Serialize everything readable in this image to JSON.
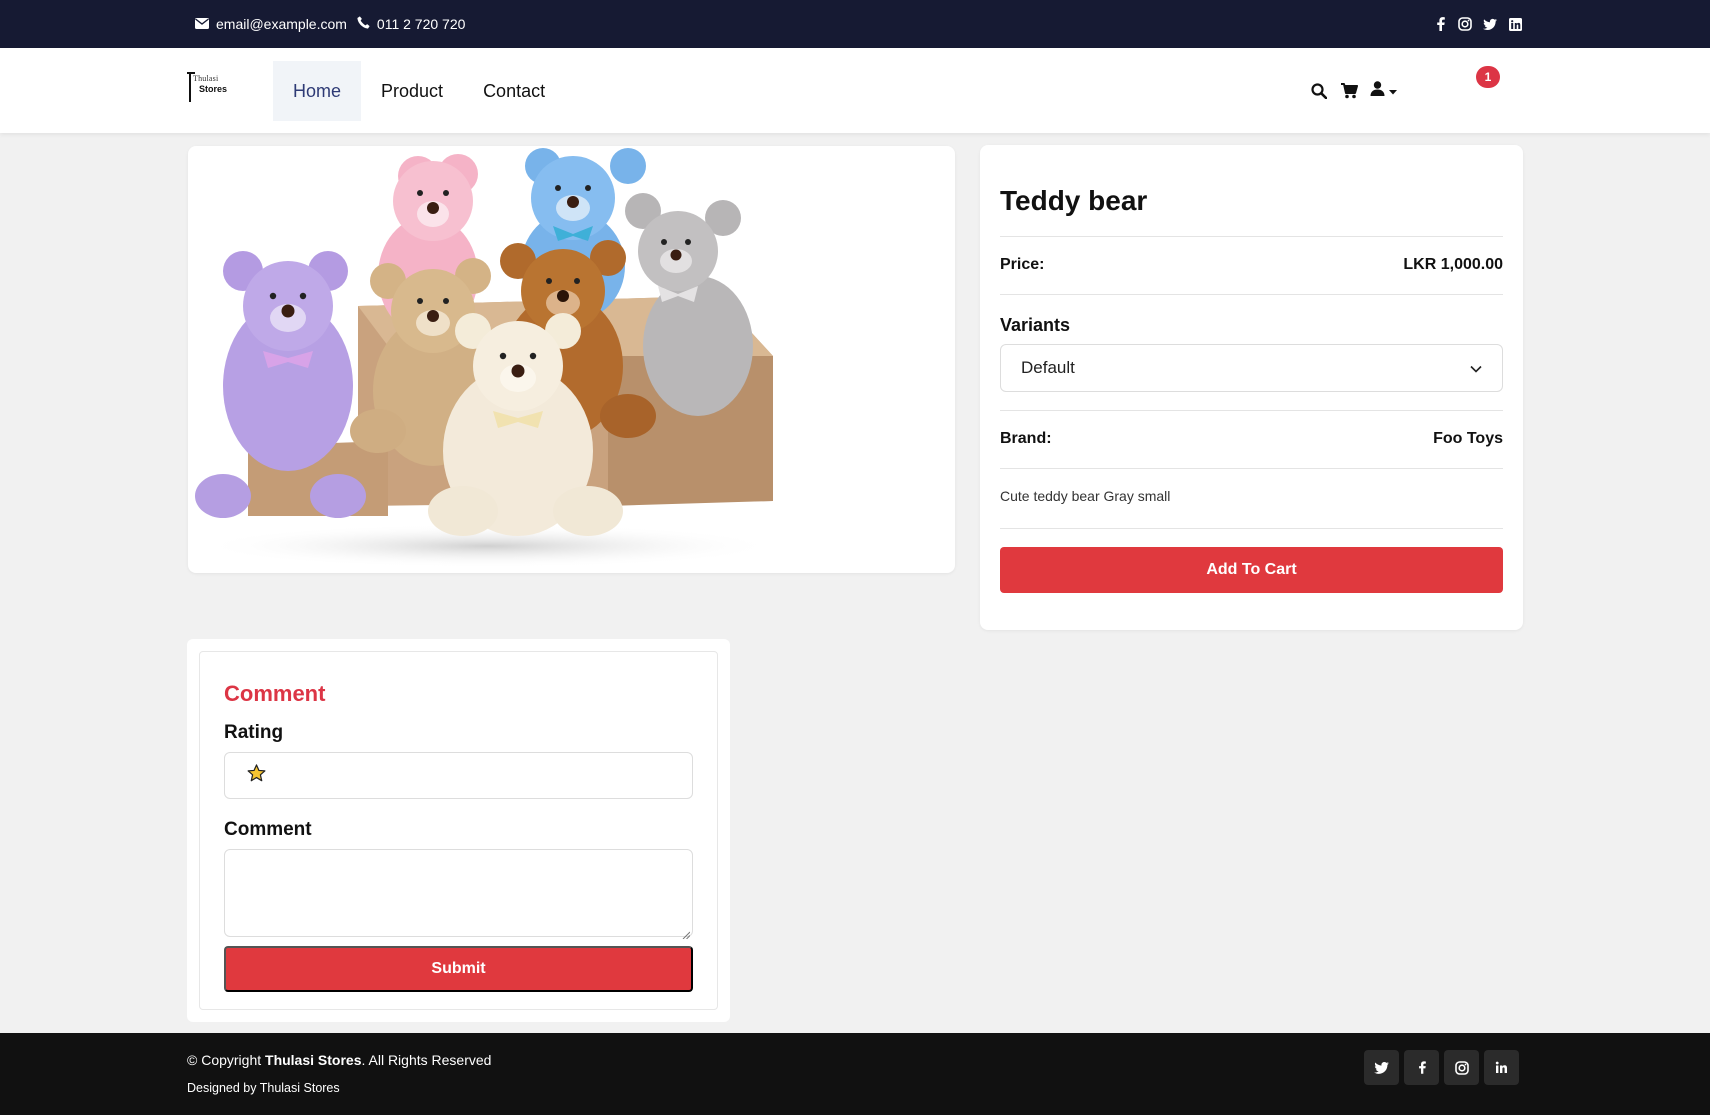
{
  "topbar": {
    "email": "email@example.com",
    "phone": "011 2 720 720",
    "social_icons": [
      "facebook-icon",
      "instagram-icon",
      "twitter-icon",
      "linkedin-icon"
    ]
  },
  "navbar": {
    "logo_line1": "Thulasi",
    "logo_line2": "Stores",
    "links": [
      {
        "label": "Home",
        "active": true
      },
      {
        "label": "Product",
        "active": false
      },
      {
        "label": "Contact",
        "active": false
      }
    ],
    "cart_count": "1"
  },
  "product": {
    "title": "Teddy bear",
    "price_label": "Price:",
    "price_value": "LKR 1,000.00",
    "variants_label": "Variants",
    "variant_selected": "Default",
    "brand_label": "Brand:",
    "brand_value": "Foo Toys",
    "description": "Cute teddy bear Gray small",
    "add_to_cart": "Add To Cart"
  },
  "comment_form": {
    "heading": "Comment",
    "rating_label": "Rating",
    "rating_value": 1,
    "comment_label": "Comment",
    "submit_label": "Submit"
  },
  "footer": {
    "copyright_prefix": "© Copyright ",
    "brand": "Thulasi Stores",
    "copyright_suffix": ". All Rights Reserved",
    "designed_by": "Designed by Thulasi Stores",
    "social_icons": [
      "twitter-icon",
      "facebook-icon",
      "instagram-icon",
      "linkedin-icon"
    ]
  },
  "colors": {
    "topbar_bg": "#161a33",
    "accent_red": "#e0393e",
    "footer_bg": "#111111",
    "page_bg": "#f1f1f1"
  }
}
